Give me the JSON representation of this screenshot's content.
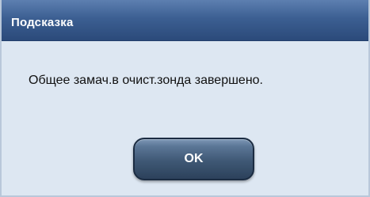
{
  "dialog": {
    "title": "Подсказка",
    "message": "Общее замач.в очист.зонда завершено.",
    "ok_label": "OK"
  }
}
